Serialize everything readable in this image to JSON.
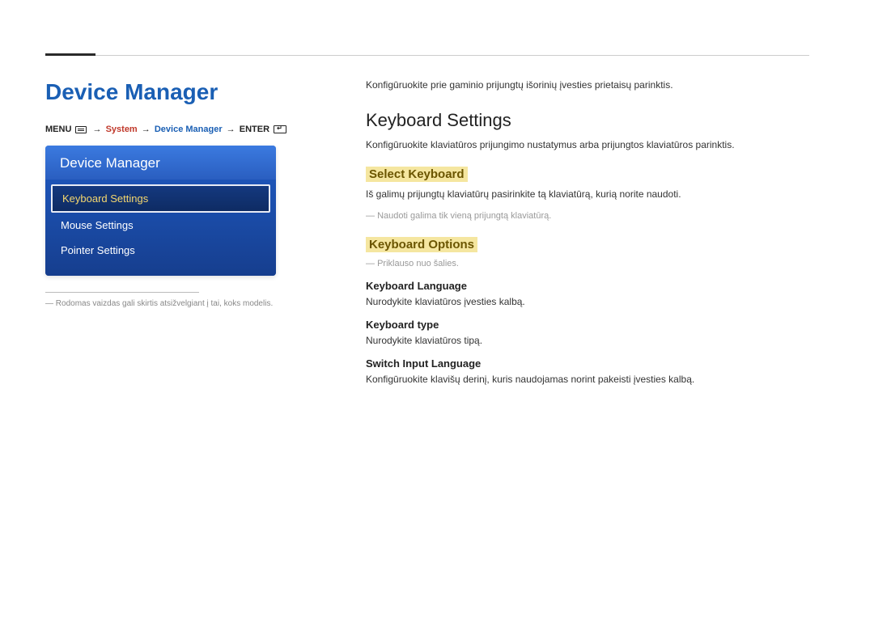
{
  "page": {
    "title": "Device Manager"
  },
  "breadcrumb": {
    "menu": "MENU",
    "system": "System",
    "device_manager": "Device Manager",
    "enter": "ENTER"
  },
  "menu_panel": {
    "header": "Device Manager",
    "items": [
      {
        "label": "Keyboard Settings",
        "selected": true
      },
      {
        "label": "Mouse Settings",
        "selected": false
      },
      {
        "label": "Pointer Settings",
        "selected": false
      }
    ]
  },
  "left_footnote": "Rodomas vaizdas gali skirtis atsižvelgiant į tai, koks modelis.",
  "content": {
    "intro": "Konfigūruokite prie gaminio prijungtų išorinių įvesties prietaisų parinktis.",
    "h2": "Keyboard Settings",
    "h2_body": "Konfigūruokite klaviatūros prijungimo nustatymus arba prijungtos klaviatūros parinktis.",
    "select_keyboard": {
      "title": "Select Keyboard",
      "body": "Iš galimų prijungtų klaviatūrų pasirinkite tą klaviatūrą, kurią norite naudoti.",
      "note": "Naudoti galima tik vieną prijungtą klaviatūrą."
    },
    "keyboard_options": {
      "title": "Keyboard Options",
      "note": "Priklauso nuo šalies.",
      "lang": {
        "title": "Keyboard Language",
        "body": "Nurodykite klaviatūros įvesties kalbą."
      },
      "type": {
        "title": "Keyboard type",
        "body": "Nurodykite klaviatūros tipą."
      },
      "switch": {
        "title": "Switch Input Language",
        "body": "Konfigūruokite klavišų derinį, kuris naudojamas norint pakeisti įvesties kalbą."
      }
    }
  }
}
